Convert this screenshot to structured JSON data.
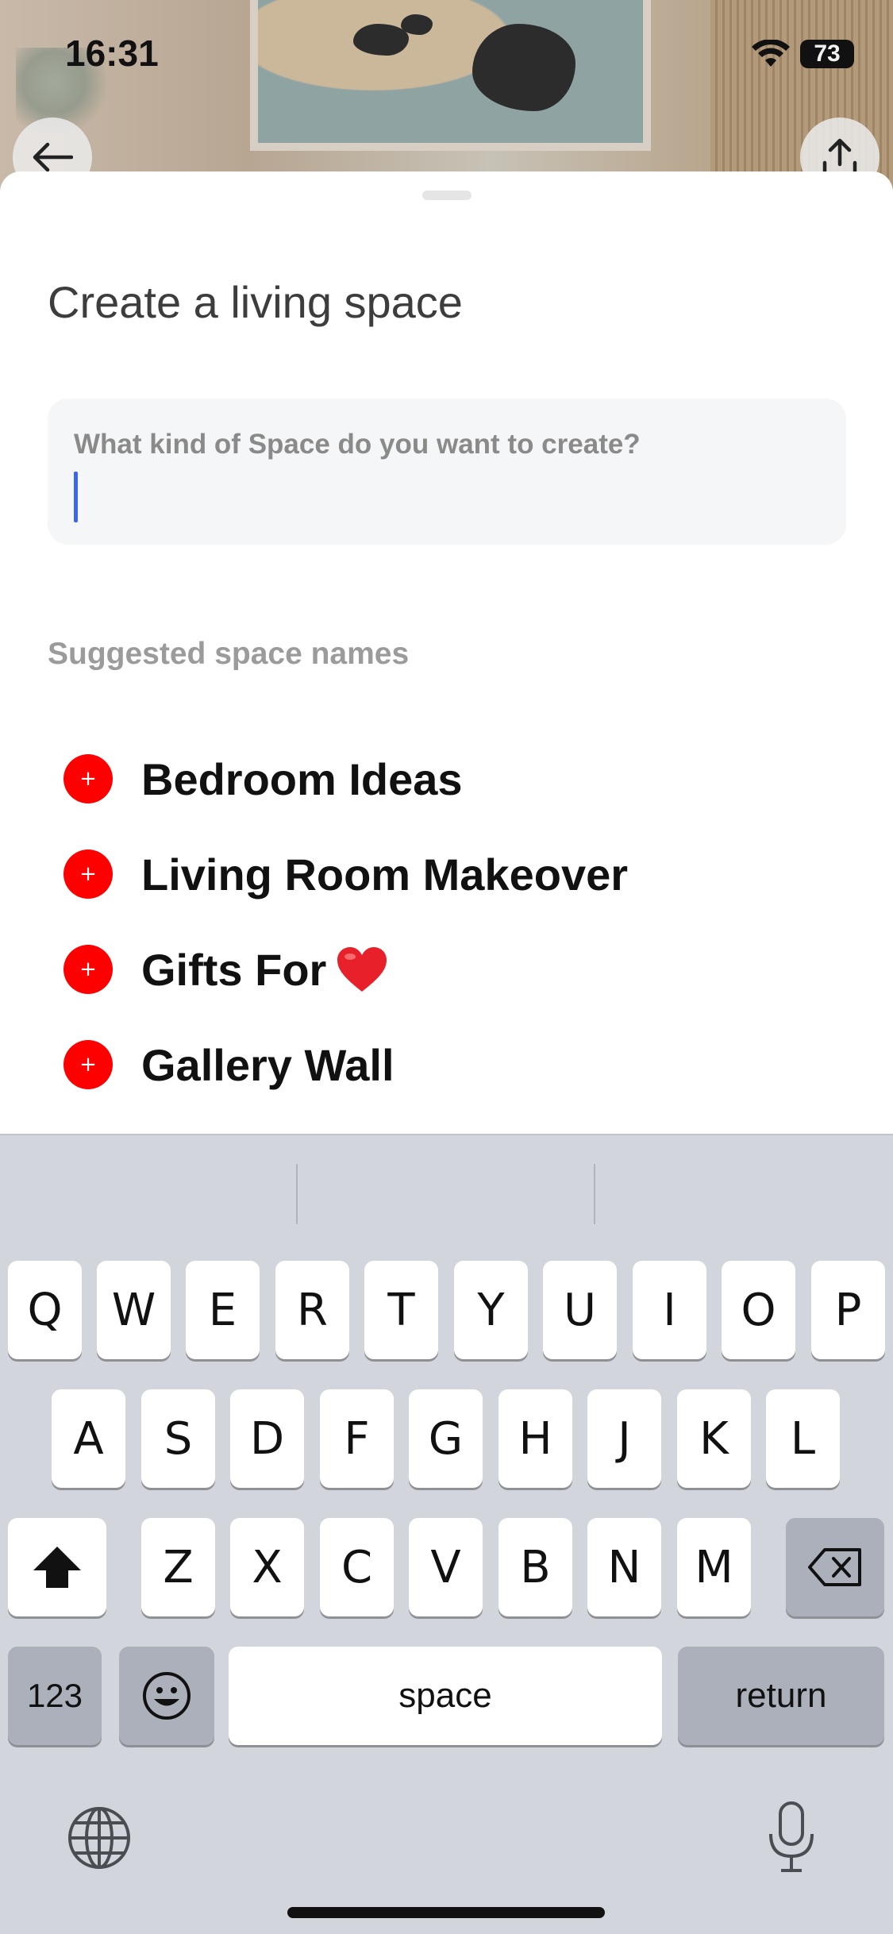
{
  "status_bar": {
    "time": "16:31",
    "battery": "73"
  },
  "sheet": {
    "title": "Create a living space",
    "input": {
      "label": "What kind of Space do you want to create?",
      "value": ""
    },
    "suggestions_heading": "Suggested space names",
    "suggestions": [
      {
        "label": "Bedroom Ideas",
        "icon": "plus-icon"
      },
      {
        "label": "Living Room Makeover",
        "icon": "plus-icon"
      },
      {
        "label": "Gifts For",
        "icon": "plus-icon",
        "emoji": "heart-icon"
      },
      {
        "label": "Gallery Wall",
        "icon": "plus-icon"
      }
    ],
    "plus_symbol": "+"
  },
  "keyboard": {
    "row1": [
      "Q",
      "W",
      "E",
      "R",
      "T",
      "Y",
      "U",
      "I",
      "O",
      "P"
    ],
    "row2": [
      "A",
      "S",
      "D",
      "F",
      "G",
      "H",
      "J",
      "K",
      "L"
    ],
    "row3": [
      "Z",
      "X",
      "C",
      "V",
      "B",
      "N",
      "M"
    ],
    "numbers_key": "123",
    "space_key": "space",
    "return_key": "return"
  },
  "colors": {
    "accent_red": "#ff0000",
    "caret_blue": "#3b67e8",
    "keyboard_bg": "#d2d5db"
  }
}
